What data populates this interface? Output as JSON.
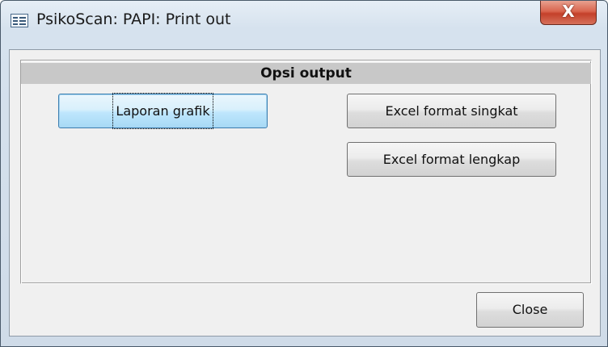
{
  "window": {
    "title": "PsikoScan: PAPI: Print out",
    "close_glyph": "X",
    "icon": "form-window-icon"
  },
  "section": {
    "header": "Opsi output"
  },
  "buttons": {
    "laporan_grafik": "Laporan grafik",
    "excel_singkat": "Excel format singkat",
    "excel_lengkap": "Excel format lengkap",
    "close": "Close"
  },
  "colors": {
    "titlebar": "#cfdbe8",
    "close_button": "#c4402a",
    "section_header_bg": "#c8c8c8",
    "focused_button": "#bee6fd"
  }
}
